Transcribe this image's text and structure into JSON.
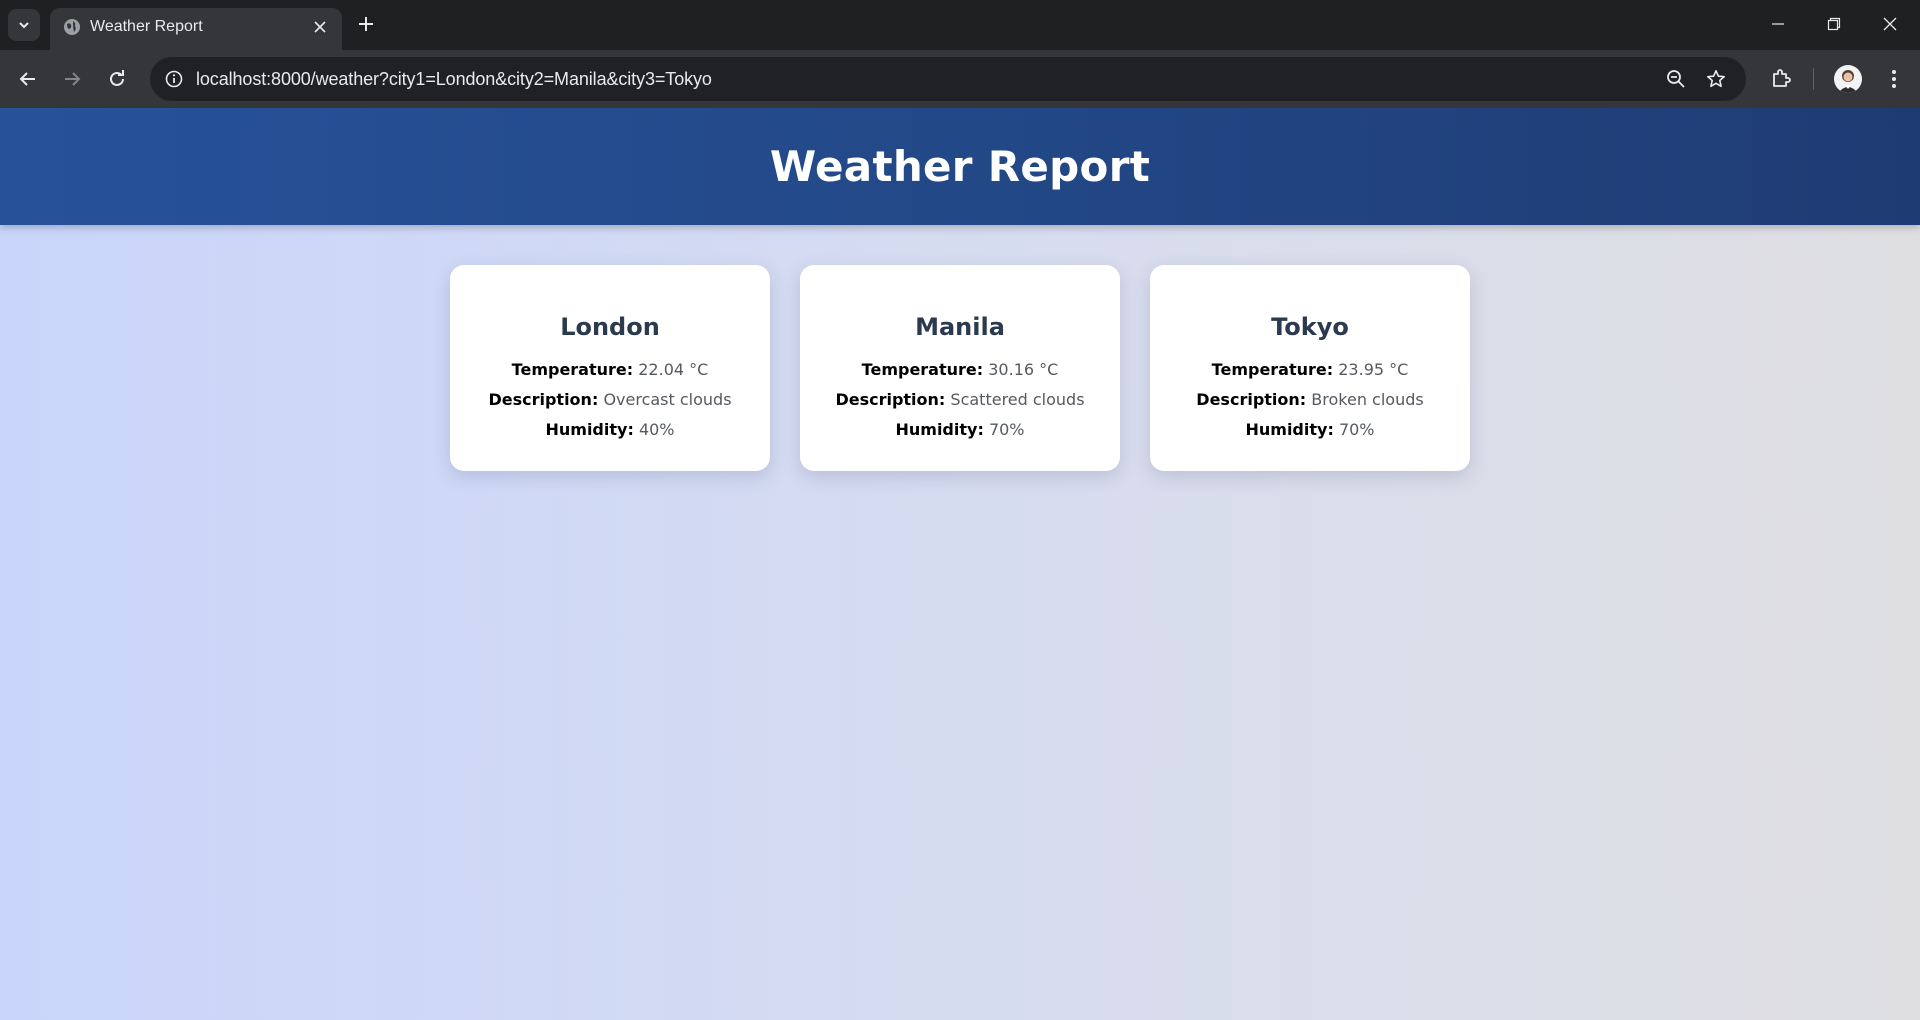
{
  "browser": {
    "tab_title": "Weather Report",
    "url": "localhost:8000/weather?city1=London&city2=Manila&city3=Tokyo"
  },
  "page": {
    "title": "Weather Report",
    "labels": {
      "temperature": "Temperature:",
      "description": "Description:",
      "humidity": "Humidity:"
    },
    "cities": [
      {
        "name": "London",
        "temperature": "22.04 °C",
        "description": "Overcast clouds",
        "humidity": "40%"
      },
      {
        "name": "Manila",
        "temperature": "30.16 °C",
        "description": "Scattered clouds",
        "humidity": "70%"
      },
      {
        "name": "Tokyo",
        "temperature": "23.95 °C",
        "description": "Broken clouds",
        "humidity": "70%"
      }
    ]
  },
  "colors": {
    "header": "#224785",
    "card_title": "#2b3a4e"
  }
}
